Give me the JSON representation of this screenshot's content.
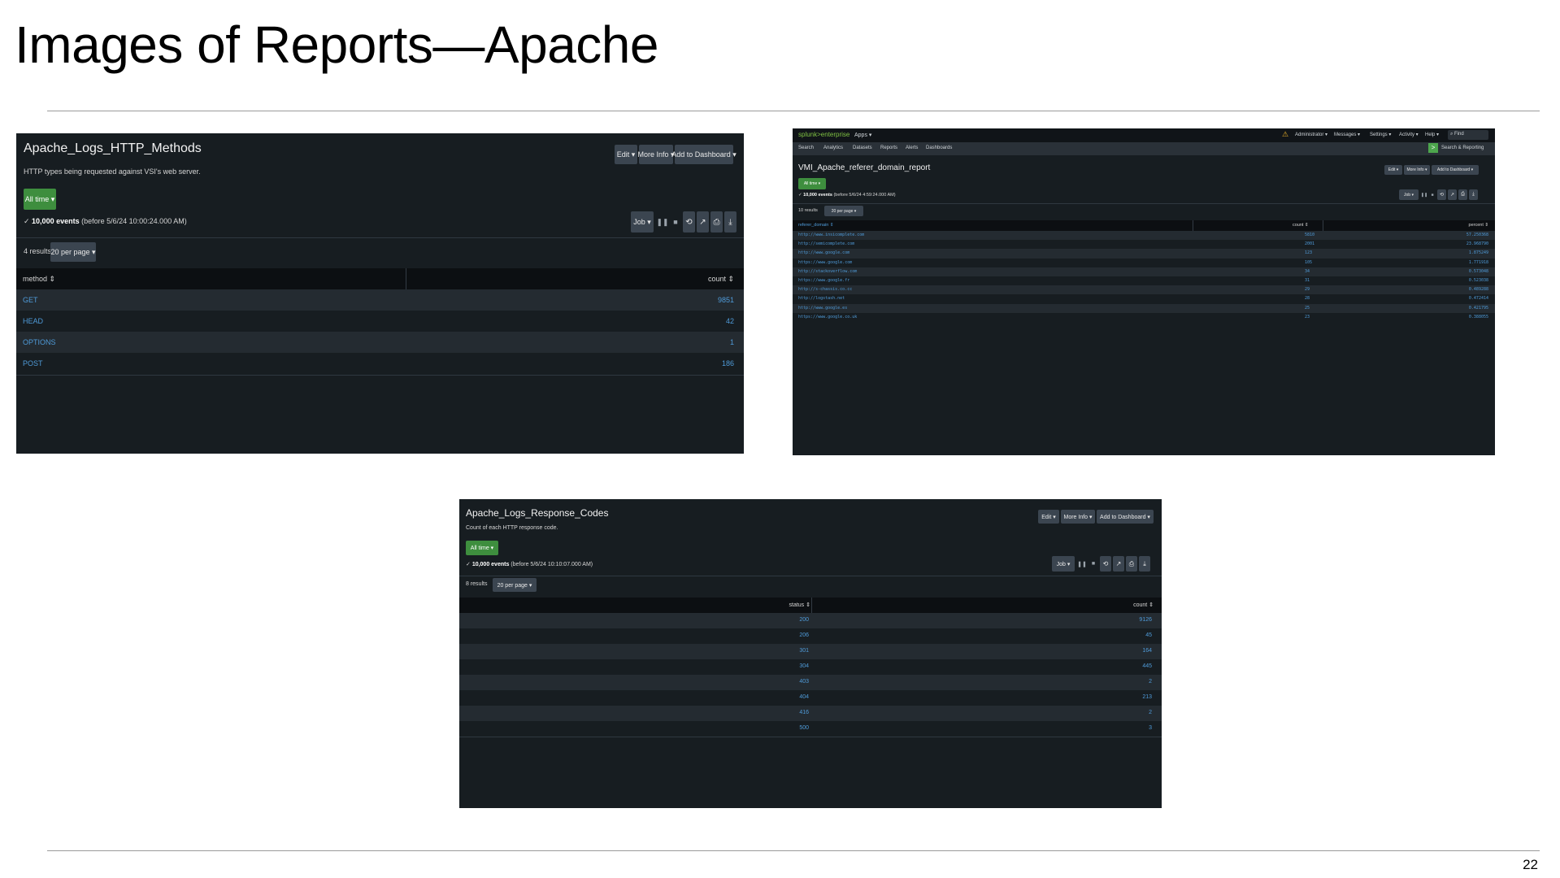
{
  "slide": {
    "title": "Images of Reports—Apache",
    "page_number": "22"
  },
  "report1": {
    "title": "Apache_Logs_HTTP_Methods",
    "description": "HTTP types being requested against VSI's web server.",
    "edit": "Edit ▾",
    "more_info": "More Info ▾",
    "add_to_dashboard": "Add to Dashboard ▾",
    "time_range": "All time ▾",
    "events_count": "10,000 events",
    "events_detail": "(before 5/6/24 10:00:24.000 AM)",
    "job": "Job ▾",
    "results": "4 results",
    "per_page": "20 per page ▾",
    "col_method": "method ⇕",
    "col_count": "count ⇕",
    "rows": [
      {
        "method": "GET",
        "count": "9851"
      },
      {
        "method": "HEAD",
        "count": "42"
      },
      {
        "method": "OPTIONS",
        "count": "1"
      },
      {
        "method": "POST",
        "count": "186"
      }
    ]
  },
  "report2": {
    "brand": "splunk>enterprise",
    "apps": "Apps ▾",
    "top_nav": [
      "Administrator ▾",
      "Messages ▾",
      "Settings ▾",
      "Activity ▾",
      "Help ▾"
    ],
    "find_placeholder": "Find",
    "app_nav": [
      "Search",
      "Analytics",
      "Datasets",
      "Reports",
      "Alerts",
      "Dashboards"
    ],
    "app_name": "Search & Reporting",
    "title": "VMI_Apache_referer_domain_report",
    "edit": "Edit ▾",
    "more_info": "More Info ▾",
    "add_to_dashboard": "Add to Dashboard ▾",
    "time_range": "All time ▾",
    "events_count": "10,000 events",
    "events_detail": "(before 5/6/24 4:59:24.000 AM)",
    "job": "Job ▾",
    "results": "10 results",
    "per_page": "20 per page ▾",
    "col_domain": "referer_domain ⇕",
    "col_count": "count ⇕",
    "col_percent": "percent ⇕",
    "rows": [
      {
        "domain": "http://www.insicomplete.com",
        "count": "5810",
        "percent": "57.250368"
      },
      {
        "domain": "http://semicomplete.com",
        "count": "2001",
        "percent": "23.968790"
      },
      {
        "domain": "http://www.google.com",
        "count": "123",
        "percent": "1.875249"
      },
      {
        "domain": "https://www.google.com",
        "count": "105",
        "percent": "1.771918"
      },
      {
        "domain": "http://stackoverflow.com",
        "count": "34",
        "percent": "0.573048"
      },
      {
        "domain": "https://www.google.fr",
        "count": "31",
        "percent": "0.523038"
      },
      {
        "domain": "http://s-chassis.co.cc",
        "count": "29",
        "percent": "0.489288"
      },
      {
        "domain": "http://logstash.net",
        "count": "28",
        "percent": "0.472414"
      },
      {
        "domain": "http://www.google.es",
        "count": "25",
        "percent": "0.421795"
      },
      {
        "domain": "https://www.google.co.uk",
        "count": "23",
        "percent": "0.388055"
      }
    ]
  },
  "report3": {
    "title": "Apache_Logs_Response_Codes",
    "description": "Count of each HTTP response code.",
    "edit": "Edit ▾",
    "more_info": "More Info ▾",
    "add_to_dashboard": "Add to Dashboard ▾",
    "time_range": "All time ▾",
    "events_count": "10,000 events",
    "events_detail": "(before 5/6/24 10:10:07.000 AM)",
    "job": "Job ▾",
    "results": "8 results",
    "per_page": "20 per page ▾",
    "col_status": "status ⇕",
    "col_count": "count ⇕",
    "rows": [
      {
        "status": "200",
        "count": "9126"
      },
      {
        "status": "206",
        "count": "45"
      },
      {
        "status": "301",
        "count": "164"
      },
      {
        "status": "304",
        "count": "445"
      },
      {
        "status": "403",
        "count": "2"
      },
      {
        "status": "404",
        "count": "213"
      },
      {
        "status": "416",
        "count": "2"
      },
      {
        "status": "500",
        "count": "3"
      }
    ]
  }
}
